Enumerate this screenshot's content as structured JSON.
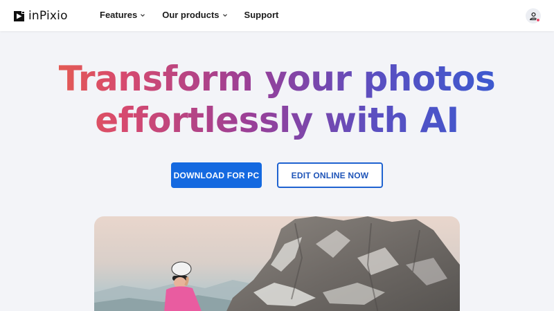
{
  "brand": {
    "name": "inPixio",
    "icon": "play-square-logo-icon"
  },
  "nav": {
    "items": [
      {
        "label": "Features",
        "has_dropdown": true
      },
      {
        "label": "Our products",
        "has_dropdown": true
      },
      {
        "label": "Support",
        "has_dropdown": false
      }
    ]
  },
  "account": {
    "icon": "user-account-icon",
    "notification_color": "#e94b6a"
  },
  "hero": {
    "title_line1": "Transform your photos",
    "title_line2": "effortlessly with AI",
    "gradient": [
      "#ee6a3c",
      "#d74a6e",
      "#9a3f97",
      "#5a4fc1",
      "#2e5ed6"
    ]
  },
  "cta": {
    "primary_label": "DOWNLOAD FOR PC",
    "secondary_label": "EDIT ONLINE NOW",
    "primary_color": "#1469e0",
    "secondary_color": "#1e62d0"
  },
  "colors": {
    "page_bg": "#f3f4f8",
    "header_bg": "#ffffff"
  }
}
